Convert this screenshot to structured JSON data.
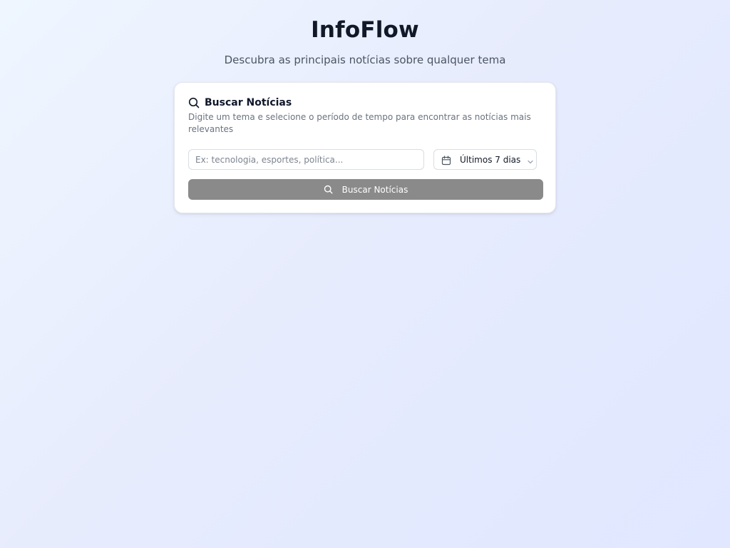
{
  "header": {
    "title": "InfoFlow",
    "subtitle": "Descubra as principais notícias sobre qualquer tema"
  },
  "search_card": {
    "title": "Buscar Notícias",
    "title_icon": "search-icon",
    "description": "Digite um tema e selecione o período de tempo para encontrar as notícias mais relevantes",
    "topic_input": {
      "value": "",
      "placeholder": "Ex: tecnologia, esportes, política..."
    },
    "period_select": {
      "icon": "calendar-icon",
      "selected": "Últimos 7 dias"
    },
    "submit_button": {
      "icon": "search-icon",
      "label": "Buscar Notícias"
    }
  },
  "colors": {
    "background_start": "#eff6ff",
    "background_end": "#e0e7ff",
    "card": "#ffffff",
    "button_disabled": "#8a8a8a",
    "title_text": "#111827",
    "muted_text": "#6b7280"
  }
}
